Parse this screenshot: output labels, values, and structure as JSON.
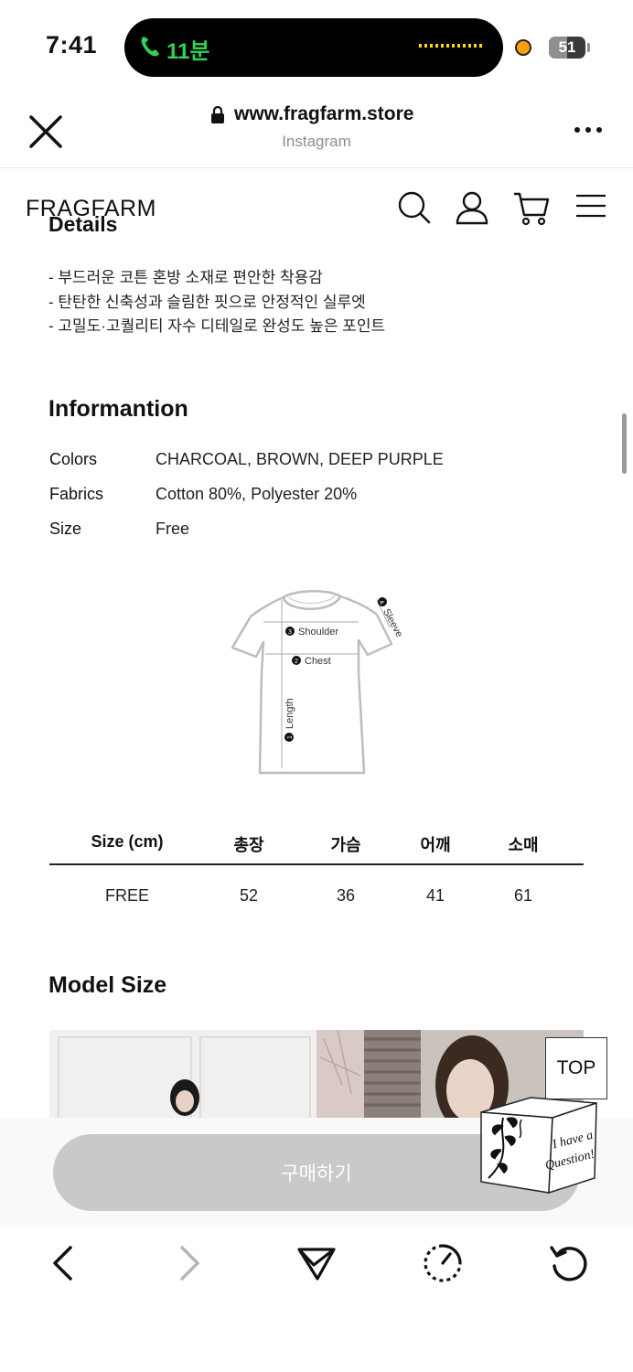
{
  "status_bar": {
    "time": "7:41",
    "call_label": "11분",
    "battery_level": "51"
  },
  "browser": {
    "url": "www.fragfarm.store",
    "source": "Instagram"
  },
  "site": {
    "brand": "FRAGFARM"
  },
  "details": {
    "title": "Details",
    "lines": [
      "- 부드러운 코튼 혼방 소재로 편안한 착용감",
      "- 탄탄한 신축성과 슬림한 핏으로 안정적인 실루엣",
      "- 고밀도·고퀄리티 자수 디테일로 완성도 높은 포인트"
    ]
  },
  "information": {
    "title": "Informantion",
    "rows": [
      {
        "key": "Colors",
        "value": "CHARCOAL, BROWN, DEEP PURPLE"
      },
      {
        "key": "Fabrics",
        "value": "Cotton 80%, Polyester 20%"
      },
      {
        "key": "Size",
        "value": "Free"
      }
    ]
  },
  "diagram": {
    "shoulder": "Shoulder",
    "chest": "Chest",
    "length": "Length",
    "sleeve": "Sleeve",
    "n1": "1",
    "n2": "2",
    "n3": "3",
    "n4": "4"
  },
  "size_table": {
    "headers": [
      "Size (cm)",
      "총장",
      "가슴",
      "어깨",
      "소매"
    ],
    "row": [
      "FREE",
      "52",
      "36",
      "41",
      "61"
    ]
  },
  "model_size": {
    "title": "Model Size"
  },
  "floating": {
    "top_label": "TOP",
    "question_line1": "I have a",
    "question_line2": "Question!"
  },
  "purchase": {
    "button_label": "구매하기"
  },
  "colors": {
    "call_green": "#31d158",
    "buy_button": "#c9c9cb",
    "record_dot": "#ff9f0a"
  },
  "nav_icons": [
    "back-icon",
    "forward-icon",
    "share-icon",
    "speed-icon",
    "reload-icon"
  ]
}
